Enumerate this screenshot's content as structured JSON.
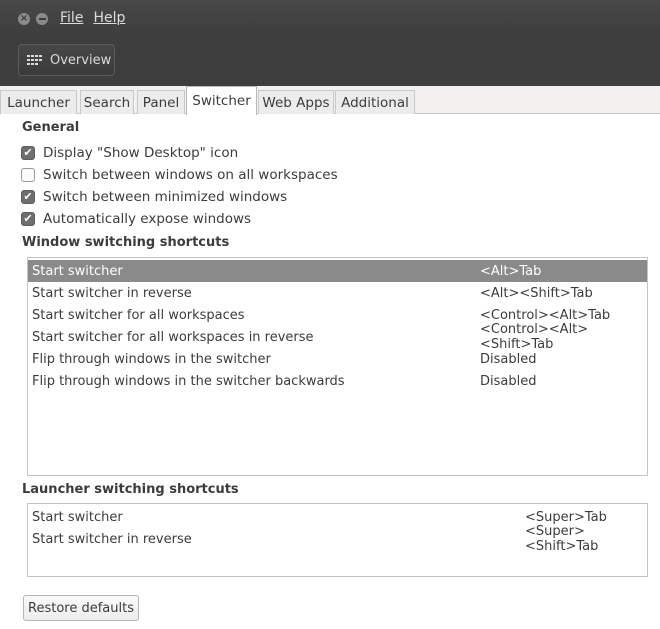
{
  "menu": {
    "file": "File",
    "help": "Help"
  },
  "toolbar": {
    "overview_label": "Overview"
  },
  "tabs": [
    "Launcher",
    "Search",
    "Panel",
    "Switcher",
    "Web Apps",
    "Additional"
  ],
  "general": {
    "title": "General",
    "options": [
      {
        "label": "Display \"Show Desktop\" icon",
        "checked": true
      },
      {
        "label": "Switch between windows on all workspaces",
        "checked": false
      },
      {
        "label": "Switch between minimized windows",
        "checked": true
      },
      {
        "label": "Automatically expose windows",
        "checked": true
      }
    ]
  },
  "window_shortcuts": {
    "title": "Window switching shortcuts",
    "rows": [
      {
        "action": "Start switcher",
        "accel": "<Alt>Tab",
        "selected": true
      },
      {
        "action": "Start switcher in reverse",
        "accel": "<Alt><Shift>Tab"
      },
      {
        "action": "Start switcher for all workspaces",
        "accel": "<Control><Alt>Tab"
      },
      {
        "action": "Start switcher for all workspaces in reverse",
        "accel": "<Control><Alt><Shift>Tab"
      },
      {
        "action": "Flip through windows in the switcher",
        "accel": "Disabled"
      },
      {
        "action": "Flip through windows in the switcher backwards",
        "accel": "Disabled"
      }
    ]
  },
  "launcher_shortcuts": {
    "title": "Launcher switching shortcuts",
    "rows": [
      {
        "action": "Start switcher",
        "accel": "<Super>Tab"
      },
      {
        "action": "Start switcher in reverse",
        "accel": "<Super><Shift>Tab"
      }
    ]
  },
  "restore_label": "Restore defaults",
  "colors": {
    "titlebar": "#3e3e3e",
    "selection": "#8a8a8a"
  }
}
